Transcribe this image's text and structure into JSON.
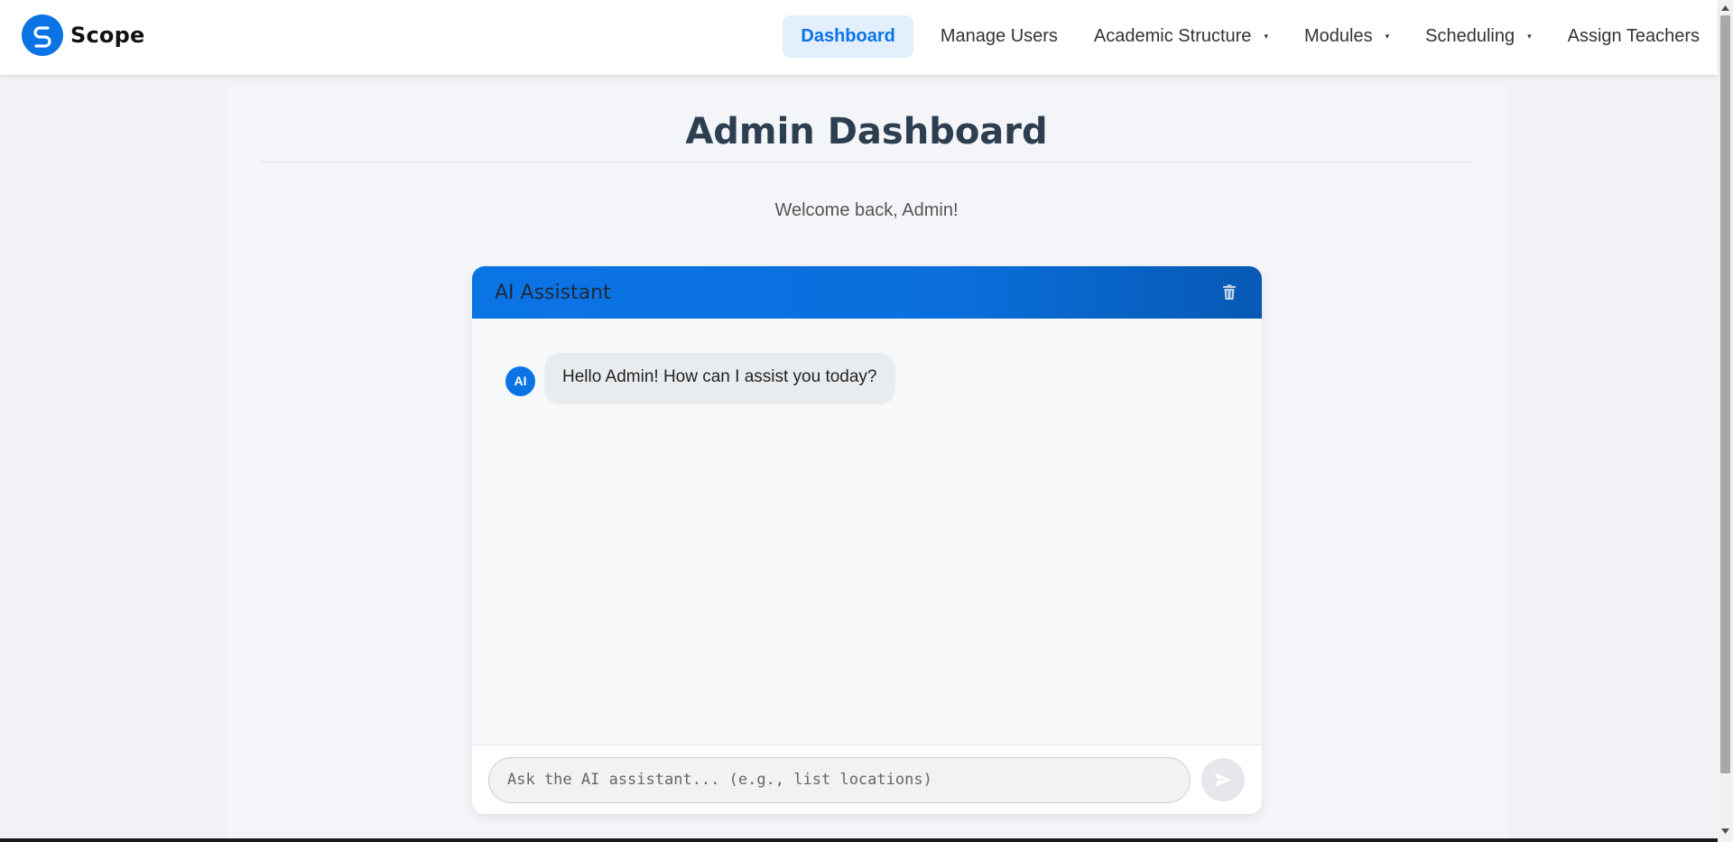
{
  "brand": {
    "name": "Scope",
    "logo_icon": "scope-s-logo"
  },
  "nav": {
    "items": [
      {
        "label": "Dashboard",
        "active": true
      },
      {
        "label": "Manage Users"
      },
      {
        "label": "Academic Structure",
        "dropdown": true
      },
      {
        "label": "Modules",
        "dropdown": true
      },
      {
        "label": "Scheduling",
        "dropdown": true
      },
      {
        "label": "Assign Teachers"
      }
    ],
    "caret": "▾"
  },
  "page": {
    "title": "Admin Dashboard",
    "welcome": "Welcome back, Admin!"
  },
  "chat": {
    "title": "AI Assistant",
    "clear_icon": "trash-icon",
    "messages": [
      {
        "sender": "AI",
        "avatar": "AI",
        "text": "Hello Admin! How can I assist you today?"
      }
    ],
    "input_placeholder": "Ask the AI assistant... (e.g., list locations)",
    "send_icon": "send-icon"
  },
  "colors": {
    "accent": "#0b74e5",
    "active_nav_bg": "#e3effd",
    "page_bg": "#f0f2f5",
    "title": "#2c3e50"
  }
}
